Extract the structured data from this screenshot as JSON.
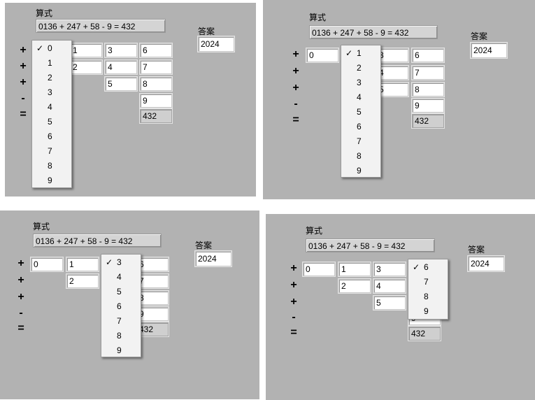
{
  "expr_label": "算式",
  "expression": "0136 + 247 + 58 - 9 = 432",
  "answer_label": "答案",
  "answer_value": "2024",
  "check_mark": "✓",
  "operators": {
    "plus1": "+",
    "plus2": "+",
    "plus3": "+",
    "minus": "-",
    "equals": "="
  },
  "column1": {
    "row1": "0"
  },
  "column2": {
    "row1": "1",
    "row2": "2"
  },
  "column3": {
    "row1": "3",
    "row2": "4",
    "row3": "5"
  },
  "column4": {
    "row1": "6",
    "row2": "7",
    "row3": "8",
    "row4": "9",
    "result": "432"
  },
  "panel_a_menu": {
    "selected": "0",
    "items": [
      "0",
      "1",
      "2",
      "3",
      "4",
      "5",
      "6",
      "7",
      "8",
      "9"
    ]
  },
  "panel_b_menu": {
    "selected": "1",
    "items": [
      "1",
      "2",
      "3",
      "4",
      "5",
      "6",
      "7",
      "8",
      "9"
    ]
  },
  "panel_c_menu": {
    "selected": "3",
    "items": [
      "3",
      "4",
      "5",
      "6",
      "7",
      "8",
      "9"
    ]
  },
  "panel_d_menu": {
    "selected": "6",
    "items": [
      "6",
      "7",
      "8",
      "9"
    ]
  }
}
